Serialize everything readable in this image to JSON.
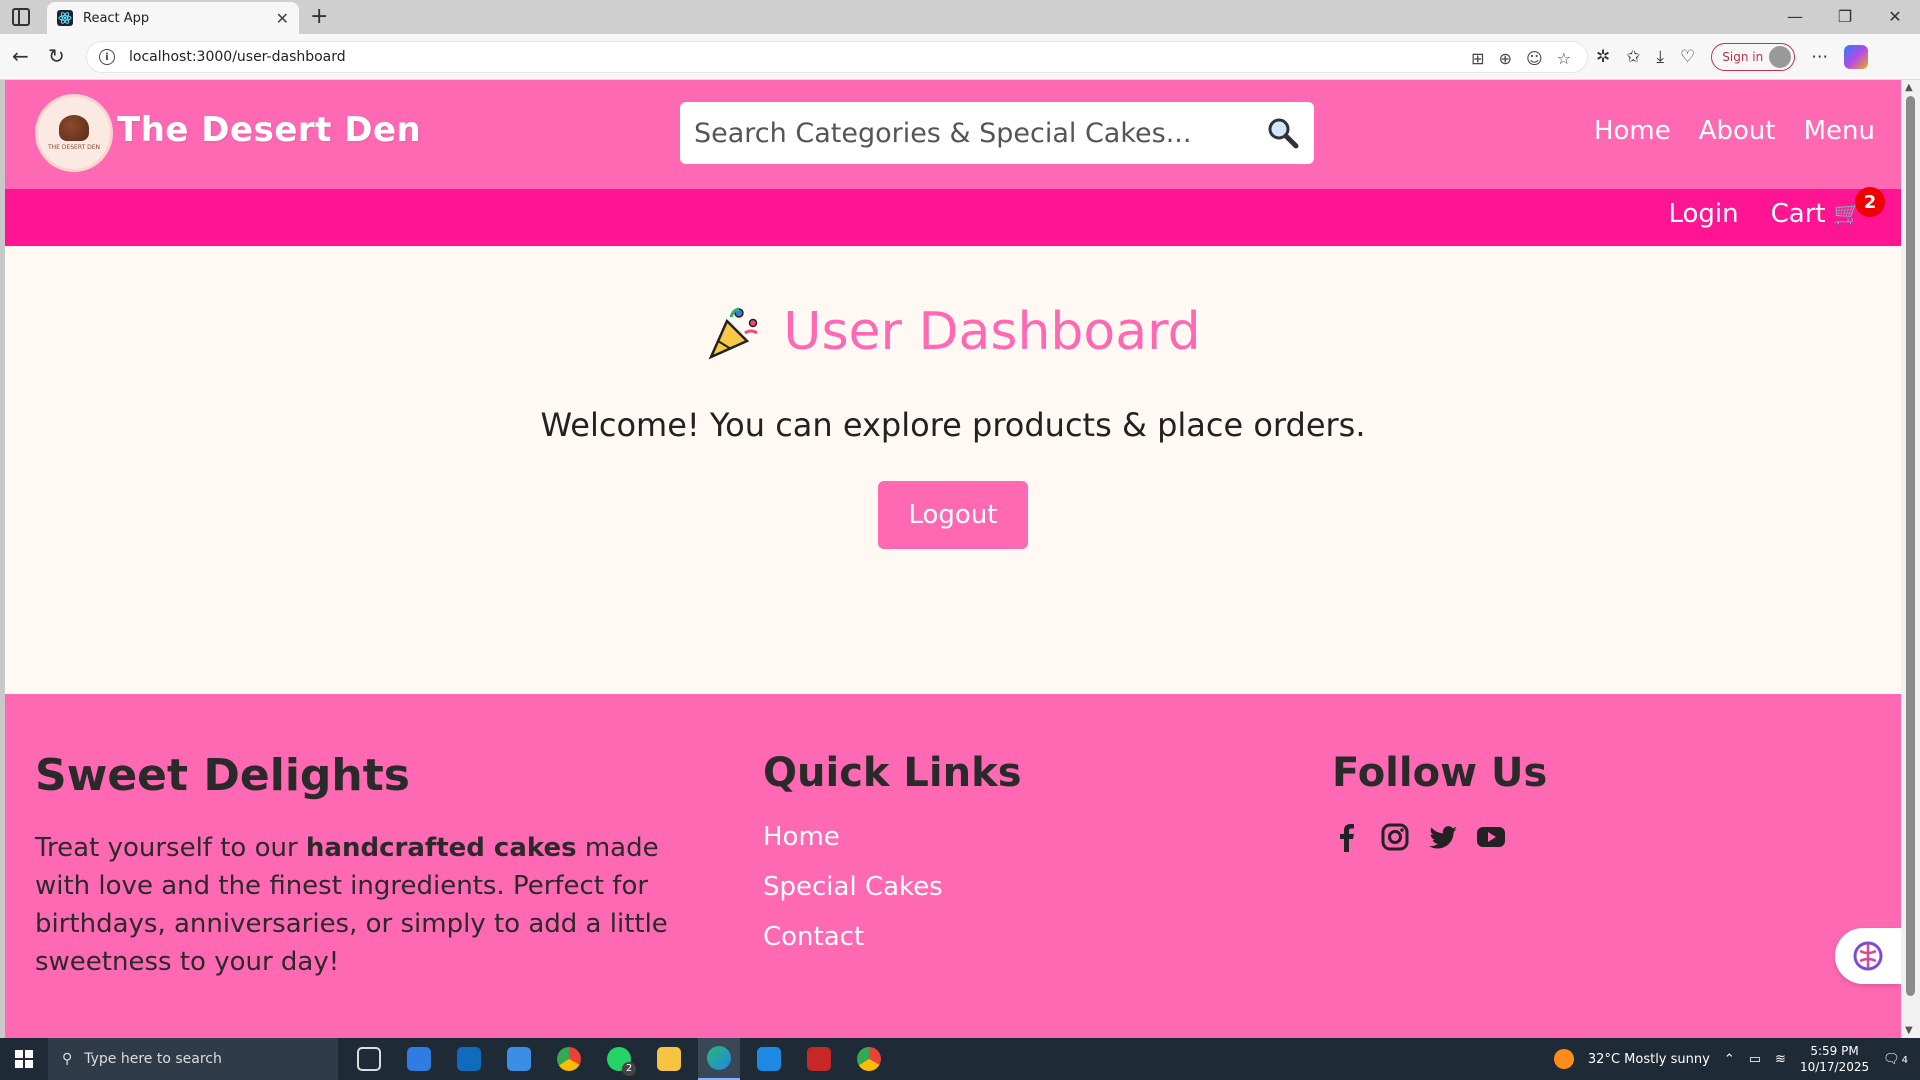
{
  "browser": {
    "tab_title": "React App",
    "url": "localhost:3000/user-dashboard",
    "signin_label": "Sign in"
  },
  "header": {
    "brand": "The Desert Den",
    "logo_text": "THE DESERT DEN",
    "search_placeholder": "Search Categories & Special Cakes...",
    "nav": [
      "Home",
      "About",
      "Menu"
    ],
    "login": "Login",
    "cart": "Cart",
    "cart_count": "2"
  },
  "main": {
    "title": "User Dashboard",
    "welcome": "Welcome! You can explore products & place orders.",
    "logout": "Logout"
  },
  "footer": {
    "col1_heading": "Sweet Delights",
    "col1_text_before": "Treat yourself to our ",
    "col1_text_bold": "handcrafted cakes",
    "col1_text_after": " made with love and the finest ingredients. Perfect for birthdays, anniversaries, or simply to add a little sweetness to your day!",
    "col2_heading": "Quick Links",
    "links": [
      "Home",
      "Special Cakes",
      "Contact"
    ],
    "col3_heading": "Follow Us",
    "social_icons": [
      "facebook-icon",
      "instagram-icon",
      "twitter-icon",
      "youtube-icon"
    ]
  },
  "taskbar": {
    "search_placeholder": "Type here to search",
    "weather": "32°C  Mostly sunny",
    "time": "5:59 PM",
    "date": "10/17/2025",
    "whatsapp_badge": "2",
    "notification_count": "4"
  },
  "colors": {
    "header_pink": "#ff69b4",
    "subheader_pink": "#ff1493",
    "background": "#fff8f3",
    "badge_red": "#e00000"
  }
}
